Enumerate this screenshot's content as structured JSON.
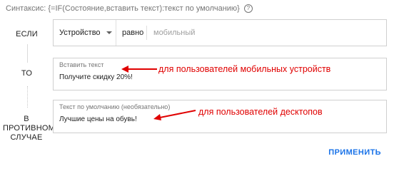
{
  "syntax": {
    "text": "Синтаксис: {=IF(Состояние,вставить текст):текст по умолчанию}",
    "help_icon": "help-circle-icon"
  },
  "labels": {
    "if": "ЕСЛИ",
    "to": "ТО",
    "else_line1": "В",
    "else_line2": "ПРОТИВНОМ",
    "else_line3": "СЛУЧАЕ"
  },
  "condition": {
    "field": "Устройство",
    "operator": "равно",
    "value": "мобильный"
  },
  "insert_text": {
    "label": "Вставить текст",
    "value": "Получите скидку 20%!"
  },
  "default_text": {
    "label": "Текст по умолчанию (необязательно)",
    "value": "Лучшие  цены на обувь!"
  },
  "annotations": {
    "mobile": "для пользователей мобильных устройств",
    "desktop": "для пользователей десктопов",
    "color": "#e00000"
  },
  "actions": {
    "apply": "ПРИМЕНИТЬ"
  },
  "colors": {
    "accent": "#1a73e8",
    "annotation": "#e00000"
  }
}
